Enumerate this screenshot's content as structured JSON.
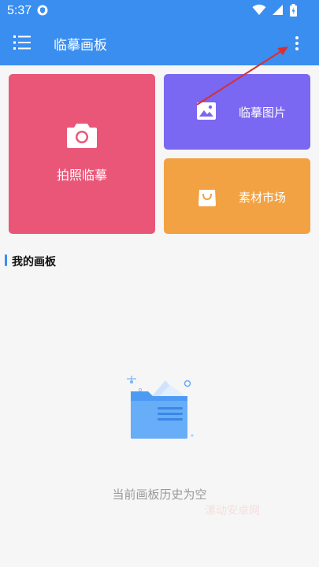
{
  "status_bar": {
    "time": "5:37"
  },
  "app_bar": {
    "title": "临摹画板"
  },
  "cards": {
    "photo_trace": {
      "label": "拍照临摹",
      "color": "#ea5678"
    },
    "trace_image": {
      "label": "临摹图片",
      "color": "#7a67f2"
    },
    "asset_market": {
      "label": "素材市场",
      "color": "#f2a243"
    }
  },
  "section": {
    "title": "我的画板"
  },
  "empty_state": {
    "text": "当前画板历史为空"
  },
  "watermark": {
    "text": "漯动安卓网"
  },
  "colors": {
    "accent": "#3a8ef0",
    "annotation_arrow": "#d9302f"
  },
  "icons": [
    "menu-icon",
    "more-vert-icon",
    "camera-icon",
    "image-icon",
    "shopping-bag-icon",
    "wifi-icon",
    "signal-icon",
    "battery-icon",
    "shield-icon"
  ]
}
